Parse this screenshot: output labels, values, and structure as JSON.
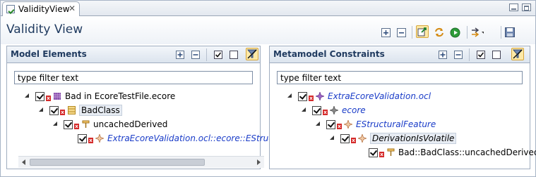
{
  "tab": {
    "label": "ValidityView",
    "close": "✕"
  },
  "header": {
    "title": "Validity View"
  },
  "colors": {
    "accent": "#1f3a5f",
    "error_marker": "#d42a2a",
    "italic_link": "#1a3cc8"
  },
  "model_panel": {
    "title": "Model Elements",
    "filter_placeholder": "type filter text",
    "items": [
      {
        "label": "Bad in EcoreTestFile.ecore",
        "icon": "resource-icon"
      },
      {
        "label": "BadClass",
        "icon": "eclass-icon"
      },
      {
        "label": "uncachedDerived",
        "icon": "eattribute-icon"
      },
      {
        "label": "ExtraEcoreValidation.ocl::ecore::EStruct",
        "icon": "constraint-icon"
      }
    ]
  },
  "metamodel_panel": {
    "title": "Metamodel Constraints",
    "filter_placeholder": "type filter text",
    "items": [
      {
        "label": "ExtraEcoreValidation.ocl",
        "icon": "ocl-resource-icon"
      },
      {
        "label": "ecore",
        "icon": "package-icon"
      },
      {
        "label": "EStructuralFeature",
        "icon": "constraint-type-icon"
      },
      {
        "label": "DerivationIsVolatile",
        "icon": "constraint-icon"
      },
      {
        "label": "Bad::BadClass::uncachedDerived",
        "icon": "eattribute-icon"
      }
    ]
  }
}
